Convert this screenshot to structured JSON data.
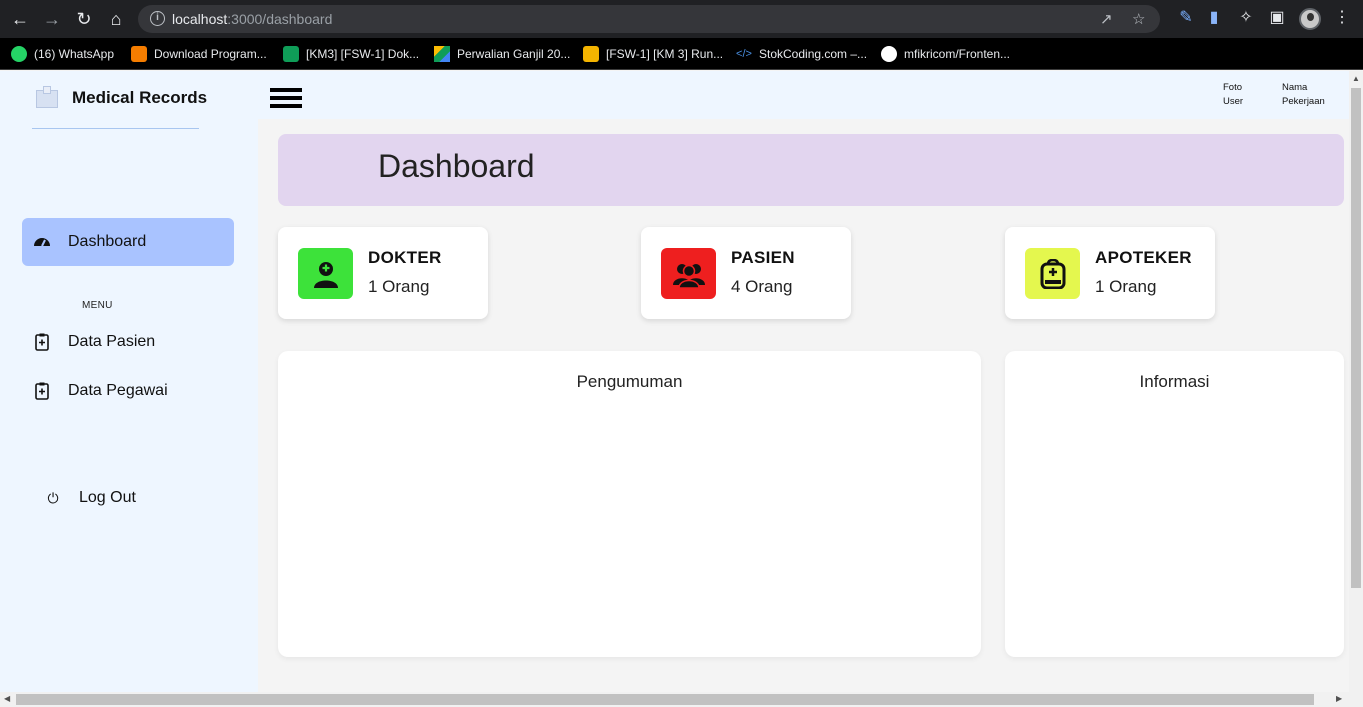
{
  "browser": {
    "url_host": "localhost",
    "url_rest": ":3000/dashboard",
    "bookmarks": [
      {
        "label": "(16) WhatsApp",
        "icon": "whatsapp-icon",
        "color": "#25d366"
      },
      {
        "label": "Download Program...",
        "icon": "blogger-icon",
        "color": "#f57d00"
      },
      {
        "label": "[KM3] [FSW-1] Dok...",
        "icon": "sheets-icon",
        "color": "#0f9d58"
      },
      {
        "label": "Perwalian Ganjil 20...",
        "icon": "drive-icon",
        "color": "#fbbc04"
      },
      {
        "label": "[FSW-1] [KM 3] Run...",
        "icon": "slides-icon",
        "color": "#f4b400"
      },
      {
        "label": "StokCoding.com –...",
        "icon": "code-icon",
        "color": "#4a90e2"
      },
      {
        "label": "mfikricom/Fronten...",
        "icon": "github-icon",
        "color": "#ffffff"
      }
    ]
  },
  "sidebar": {
    "brand": "Medical Records",
    "items": [
      {
        "label": "Dashboard",
        "icon": "gauge-icon"
      },
      {
        "label": "Data Pasien",
        "icon": "clipboard-plus-icon"
      },
      {
        "label": "Data Pegawai",
        "icon": "clipboard-plus-icon"
      }
    ],
    "menu_label": "MENU",
    "logout": "Log Out"
  },
  "topbar": {
    "user_photo_line1": "Foto",
    "user_photo_line2": "User",
    "user_name_line1": "Nama",
    "user_name_line2": "Pekerjaan"
  },
  "main": {
    "page_title": "Dashboard",
    "stats": [
      {
        "name": "DOKTER",
        "count": "1 Orang",
        "color": "#3de23a",
        "icon": "doctor-icon"
      },
      {
        "name": "PASIEN",
        "count": "4 Orang",
        "color": "#ee1f1f",
        "icon": "users-icon"
      },
      {
        "name": "APOTEKER",
        "count": "1 Orang",
        "color": "#e4f74e",
        "icon": "medical-bag-icon"
      }
    ],
    "panels": {
      "announcements": "Pengumuman",
      "information": "Informasi"
    }
  }
}
